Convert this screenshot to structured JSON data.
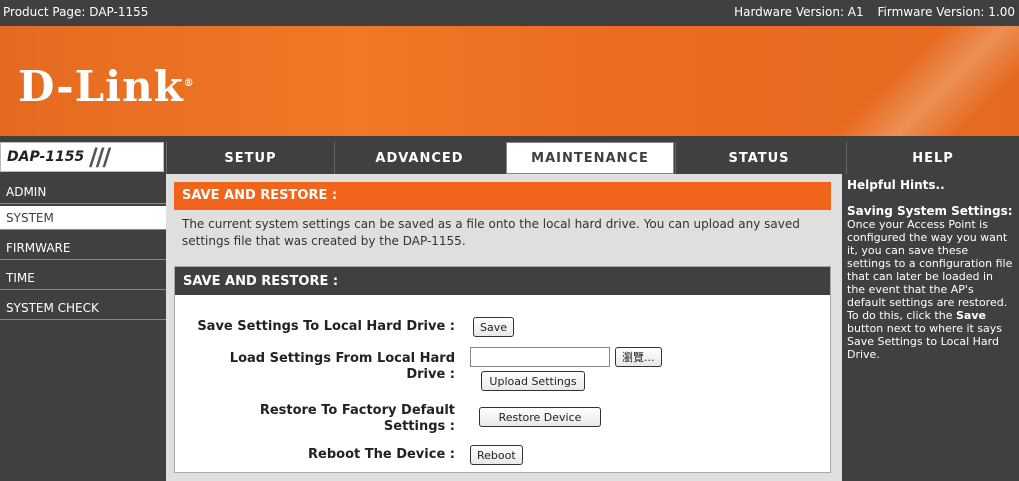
{
  "topbar": {
    "product": "Product Page: DAP-1155",
    "hardware": "Hardware Version: A1",
    "firmware": "Firmware Version: 1.00"
  },
  "logo": {
    "text": "D-Link",
    "mark": "®"
  },
  "model": {
    "label": "DAP-1155",
    "slashes": "///"
  },
  "tabs": [
    {
      "label": "SETUP"
    },
    {
      "label": "ADVANCED"
    },
    {
      "label": "MAINTENANCE"
    },
    {
      "label": "STATUS"
    },
    {
      "label": "HELP"
    }
  ],
  "sidebar": {
    "items": [
      {
        "label": "ADMIN"
      },
      {
        "label": "SYSTEM"
      },
      {
        "label": "FIRMWARE"
      },
      {
        "label": "TIME"
      },
      {
        "label": "SYSTEM CHECK"
      }
    ]
  },
  "main": {
    "section1_title": "SAVE AND RESTORE :",
    "description": "The current system settings can be saved as a file onto the local hard drive. You can upload any saved settings file that was created by the DAP-1155.",
    "section2_title": "SAVE AND RESTORE :",
    "save_label": "Save Settings To Local Hard Drive :",
    "save_button": "Save",
    "load_label_line1": "Load Settings From Local Hard",
    "load_label_line2": "Drive :",
    "browse_button": "瀏覽...",
    "upload_button": "Upload Settings",
    "restore_label_line1": "Restore To Factory Default",
    "restore_label_line2": "Settings :",
    "restore_button": "Restore Device",
    "reboot_label": "Reboot The Device :",
    "reboot_button": "Reboot"
  },
  "help": {
    "title": "Helpful Hints..",
    "subtitle": "Saving System Settings:",
    "body_part1": "Once your Access Point is configured the way you want it, you can save these settings to a configuration file that can later be loaded in the event that the AP's default settings are restored. To do this, click the ",
    "body_bold": "Save",
    "body_part2": " button next to where it says Save Settings to Local Hard Drive."
  },
  "colors": {
    "accent_orange": "#f0641c",
    "dark_gray": "#404040"
  }
}
